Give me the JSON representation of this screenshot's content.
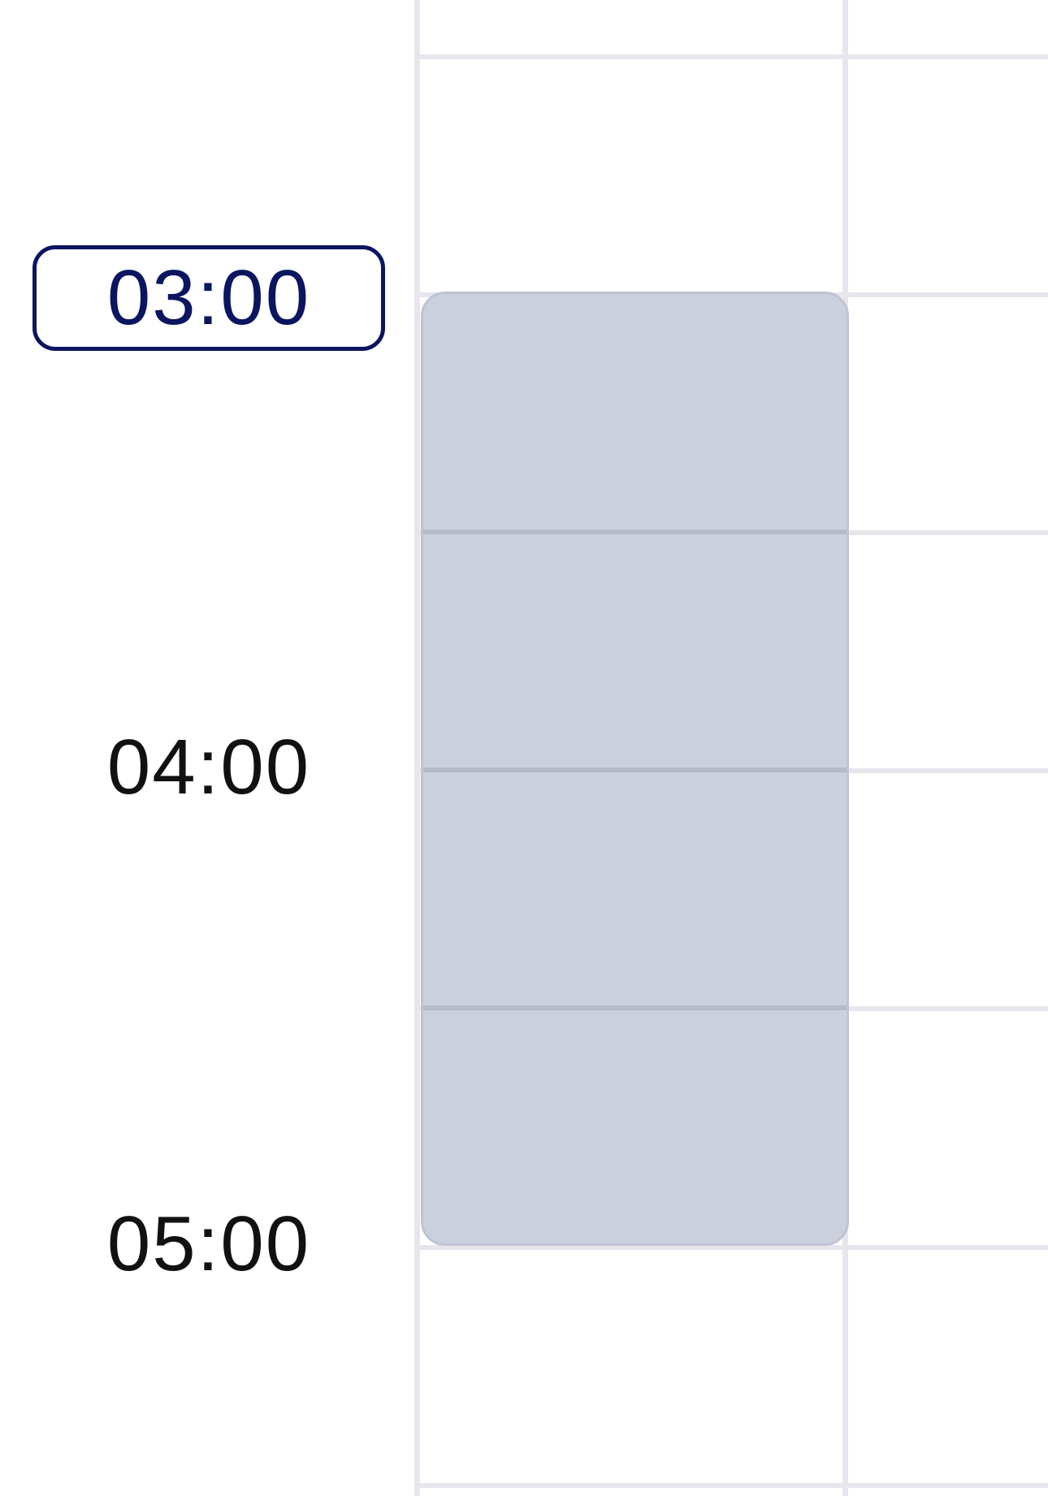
{
  "time_gutter": {
    "labels": [
      {
        "text": "03:00",
        "current": true
      },
      {
        "text": "04:00",
        "current": false
      },
      {
        "text": "05:00",
        "current": false
      }
    ]
  },
  "colors": {
    "current_time_accent": "#0b1560",
    "grid_line": "#e6e6ec",
    "selected_slot_fill": "#ccd0dd"
  }
}
